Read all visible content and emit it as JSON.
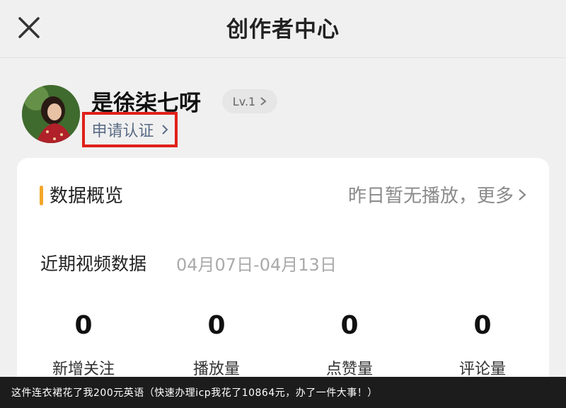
{
  "header": {
    "title": "创作者中心",
    "close_icon": "close-icon"
  },
  "profile": {
    "username": "是徐柒七呀",
    "level": "Lv.1",
    "certification_link": "申请认证",
    "highlight_color": "#e0201a"
  },
  "overview": {
    "title": "数据概览",
    "accent_color": "#f4a72b",
    "more_text": "昨日暂无播放，更多",
    "recent_label": "近期视频数据",
    "date_range": "04月07日-04月13日",
    "stats": [
      {
        "value": "0",
        "label": "新增关注"
      },
      {
        "value": "0",
        "label": "播放量"
      },
      {
        "value": "0",
        "label": "点赞量"
      },
      {
        "value": "0",
        "label": "评论量"
      }
    ]
  },
  "caption": {
    "text": "这件连衣裙花了我200元英语（快速办理icp我花了10864元，办了一件大事！）"
  }
}
